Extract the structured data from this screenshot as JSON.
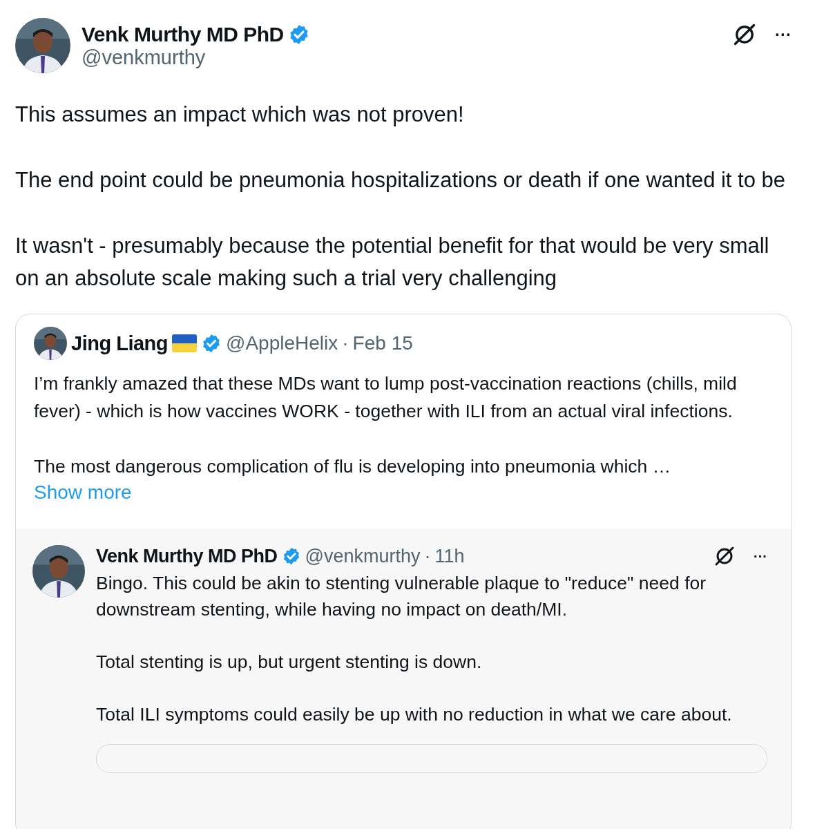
{
  "post": {
    "author": {
      "name": "Venk Murthy MD PhD",
      "handle": "@venkmurthy",
      "verified": true
    },
    "paragraphs": [
      "This assumes an impact which was not proven!",
      "The end point could be pneumonia hospitalizations or death if one wanted it to be",
      "It wasn't - presumably because the potential benefit for that would be very small on an absolute scale making such a trial very challenging"
    ],
    "more_label": "···",
    "quote": {
      "author": {
        "name": "Jing Liang",
        "handle": "@AppleHelix",
        "verified": true,
        "flag": true
      },
      "separator": "·",
      "date": "Feb 15",
      "paragraphs": [
        "I’m frankly amazed that these MDs want to lump post-vaccination reactions (chills, mild fever) - which is how vaccines WORK - together with ILI from an actual viral infections.",
        "The most dangerous complication of flu is developing into pneumonia which …"
      ],
      "show_more": "Show more",
      "reply": {
        "author": {
          "name": "Venk Murthy MD PhD",
          "handle": "@venkmurthy",
          "verified": true
        },
        "separator": "·",
        "time": "11h",
        "more_label": "···",
        "paragraphs": [
          "Bingo. This could be akin to stenting vulnerable plaque to \"reduce\" need for downstream stenting, while having no impact on death/MI.",
          "Total stenting is up, but urgent stenting is down.",
          "Total ILI symptoms could easily be up with no reduction in what we care about."
        ]
      }
    }
  }
}
